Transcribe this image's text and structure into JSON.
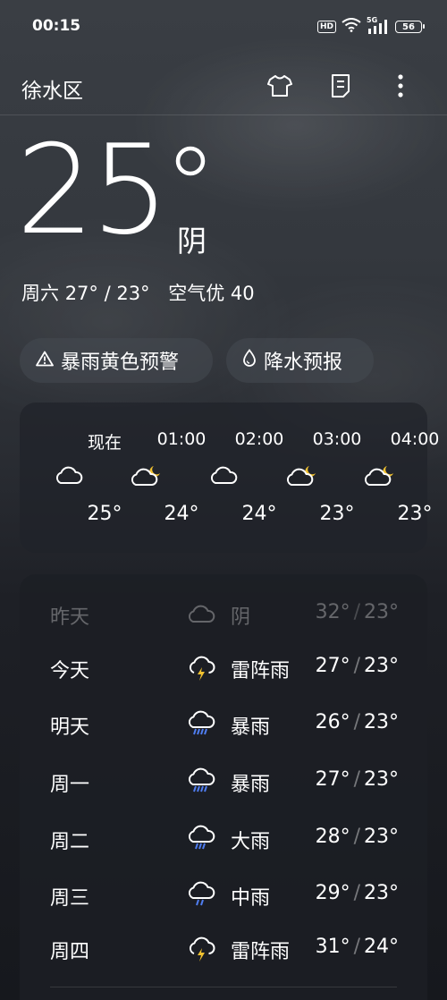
{
  "status_bar": {
    "time": "00:15",
    "hd": "HD",
    "network": "5G",
    "battery": "56"
  },
  "header": {
    "location": "徐水区",
    "icons": [
      "shirt-icon",
      "document-icon",
      "more-vertical-icon"
    ]
  },
  "current": {
    "temp": "25",
    "condition": "阴",
    "day": "周六",
    "high_low": "27° / 23°",
    "air_quality": "空气优 40"
  },
  "pills": {
    "warning": "暴雨黄色预警",
    "precip": "降水预报"
  },
  "hourly": [
    {
      "time": "现在",
      "icon": "cloud-icon",
      "temp": "25°"
    },
    {
      "time": "01:00",
      "icon": "cloud-moon-icon",
      "temp": "24°"
    },
    {
      "time": "02:00",
      "icon": "cloud-icon",
      "temp": "24°"
    },
    {
      "time": "03:00",
      "icon": "cloud-moon-icon",
      "temp": "23°"
    },
    {
      "time": "04:00",
      "icon": "cloud-moon-icon",
      "temp": "23°"
    }
  ],
  "daily": [
    {
      "day": "昨天",
      "icon": "cloud-icon",
      "condition": "阴",
      "high": "32°",
      "low": "23°",
      "past": true
    },
    {
      "day": "今天",
      "icon": "thunderstorm-icon",
      "condition": "雷阵雨",
      "high": "27°",
      "low": "23°"
    },
    {
      "day": "明天",
      "icon": "heavy-rain-icon",
      "condition": "暴雨",
      "high": "26°",
      "low": "23°"
    },
    {
      "day": "周一",
      "icon": "heavy-rain-icon",
      "condition": "暴雨",
      "high": "27°",
      "low": "23°"
    },
    {
      "day": "周二",
      "icon": "rain-icon",
      "condition": "大雨",
      "high": "28°",
      "low": "23°"
    },
    {
      "day": "周三",
      "icon": "rain-icon",
      "condition": "中雨",
      "high": "29°",
      "low": "23°"
    },
    {
      "day": "周四",
      "icon": "thunderstorm-icon",
      "condition": "雷阵雨",
      "high": "31°",
      "low": "24°"
    }
  ],
  "colors": {
    "rain_drop": "#4f7df0",
    "bolt": "#f2c230",
    "moon": "#f2c230"
  }
}
